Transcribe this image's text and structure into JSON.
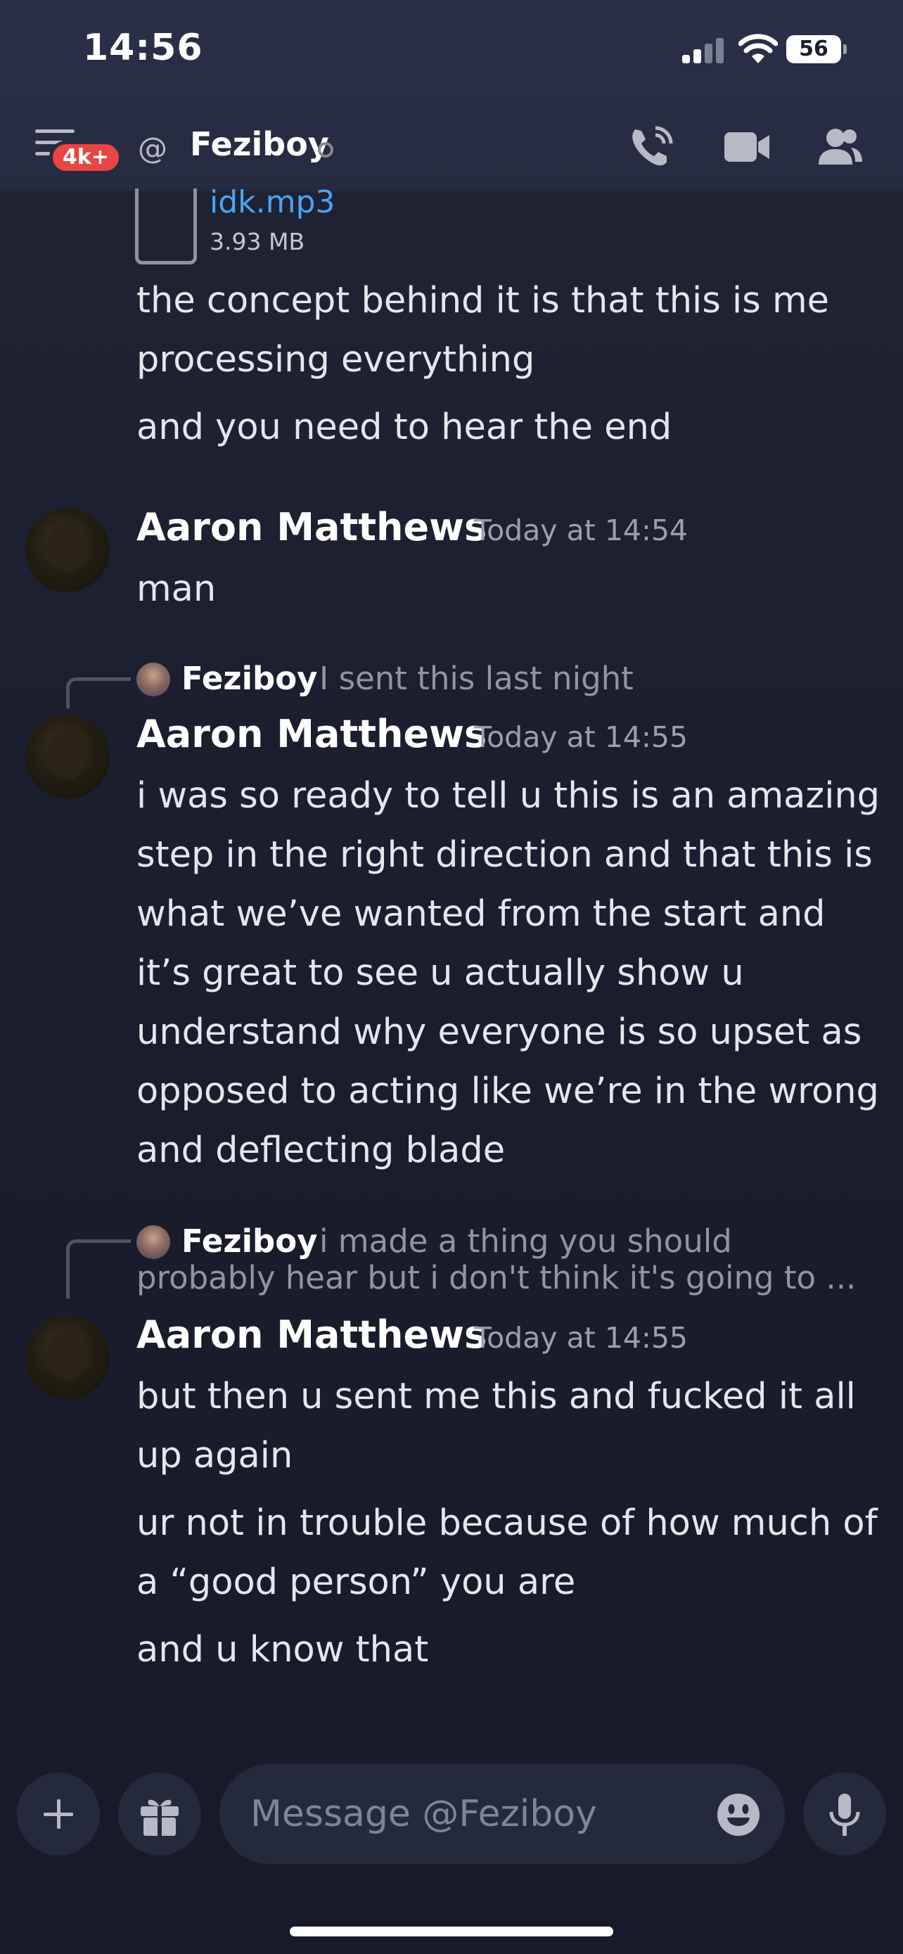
{
  "status_bar": {
    "time": "14:56",
    "battery": "56"
  },
  "header": {
    "unread_badge": "4k+",
    "channel_name": "Feziboy"
  },
  "attachment": {
    "file_name": "idk.mp3",
    "file_size": "3.93 MB"
  },
  "messages": [
    {
      "text": "the concept behind it is that this is me processing everything"
    },
    {
      "text": "and you need to hear the end"
    },
    {
      "author": "Aaron Matthews",
      "timestamp": "Today at 14:54",
      "lines": [
        "man"
      ]
    },
    {
      "reply": {
        "author": "Feziboy",
        "text": "I sent this last night"
      },
      "author": "Aaron Matthews",
      "timestamp": "Today at 14:55",
      "lines": [
        "i was so ready to tell u this is an amazing step in the right direction and that this is what we’ve wanted from the start and it’s great to see u actually show u understand why everyone is so upset as opposed to acting like we’re in the wrong and deflecting blade"
      ]
    },
    {
      "reply": {
        "author": "Feziboy",
        "text_line1": "i made a thing you should",
        "text_line2": "probably hear but i don't think it's going to ..."
      },
      "author": "Aaron Matthews",
      "timestamp": "Today at 14:55",
      "lines": [
        "but then u sent me this and fucked it all up again",
        "ur not in trouble because of how much of a “good person” you are",
        "and u know that"
      ]
    }
  ],
  "composer": {
    "placeholder": "Message @Feziboy"
  },
  "colors": {
    "link": "#4ca3f0",
    "badge": "#e84545",
    "background": "#1b1e2e"
  }
}
